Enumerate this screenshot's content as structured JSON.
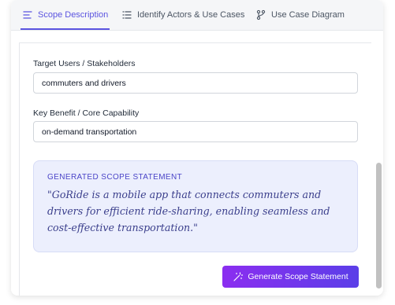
{
  "tabs": [
    {
      "label": "Scope Description",
      "icon": "align-left-icon",
      "active": true
    },
    {
      "label": "Identify Actors & Use Cases",
      "icon": "list-icon",
      "active": false
    },
    {
      "label": "Use Case Diagram",
      "icon": "diagram-icon",
      "active": false
    }
  ],
  "form": {
    "target_users_label": "Target Users / Stakeholders",
    "target_users_value": "commuters and drivers",
    "key_benefit_label": "Key Benefit / Core Capability",
    "key_benefit_value": "on-demand transportation"
  },
  "statement": {
    "title": "GENERATED SCOPE STATEMENT",
    "text": "\"GoRide is a mobile app that connects commuters and drivers for efficient ride-sharing, enabling seamless and cost-effective transportation.\""
  },
  "actions": {
    "generate_label": "Generate Scope Statement",
    "generate_icon": "magic-wand-icon"
  },
  "colors": {
    "accent": "#5b54e0",
    "statement_bg": "#eceffd",
    "button_gradient_start": "#8b2ef0",
    "button_gradient_end": "#5b3ee8"
  }
}
